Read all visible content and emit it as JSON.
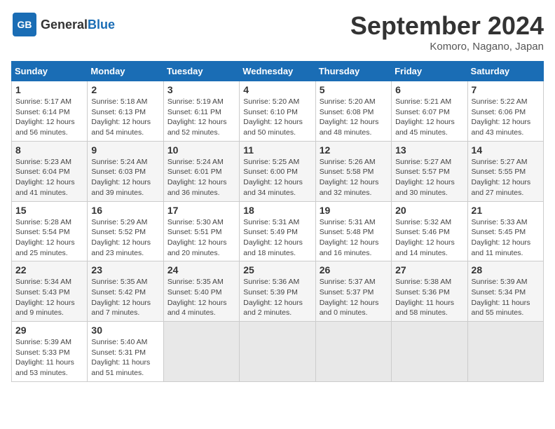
{
  "header": {
    "logo_general": "General",
    "logo_blue": "Blue",
    "month_title": "September 2024",
    "location": "Komoro, Nagano, Japan"
  },
  "days_of_week": [
    "Sunday",
    "Monday",
    "Tuesday",
    "Wednesday",
    "Thursday",
    "Friday",
    "Saturday"
  ],
  "weeks": [
    [
      {
        "day": "1",
        "sunrise": "5:17 AM",
        "sunset": "6:14 PM",
        "daylight": "12 hours and 56 minutes."
      },
      {
        "day": "2",
        "sunrise": "5:18 AM",
        "sunset": "6:13 PM",
        "daylight": "12 hours and 54 minutes."
      },
      {
        "day": "3",
        "sunrise": "5:19 AM",
        "sunset": "6:11 PM",
        "daylight": "12 hours and 52 minutes."
      },
      {
        "day": "4",
        "sunrise": "5:20 AM",
        "sunset": "6:10 PM",
        "daylight": "12 hours and 50 minutes."
      },
      {
        "day": "5",
        "sunrise": "5:20 AM",
        "sunset": "6:08 PM",
        "daylight": "12 hours and 48 minutes."
      },
      {
        "day": "6",
        "sunrise": "5:21 AM",
        "sunset": "6:07 PM",
        "daylight": "12 hours and 45 minutes."
      },
      {
        "day": "7",
        "sunrise": "5:22 AM",
        "sunset": "6:06 PM",
        "daylight": "12 hours and 43 minutes."
      }
    ],
    [
      {
        "day": "8",
        "sunrise": "5:23 AM",
        "sunset": "6:04 PM",
        "daylight": "12 hours and 41 minutes."
      },
      {
        "day": "9",
        "sunrise": "5:24 AM",
        "sunset": "6:03 PM",
        "daylight": "12 hours and 39 minutes."
      },
      {
        "day": "10",
        "sunrise": "5:24 AM",
        "sunset": "6:01 PM",
        "daylight": "12 hours and 36 minutes."
      },
      {
        "day": "11",
        "sunrise": "5:25 AM",
        "sunset": "6:00 PM",
        "daylight": "12 hours and 34 minutes."
      },
      {
        "day": "12",
        "sunrise": "5:26 AM",
        "sunset": "5:58 PM",
        "daylight": "12 hours and 32 minutes."
      },
      {
        "day": "13",
        "sunrise": "5:27 AM",
        "sunset": "5:57 PM",
        "daylight": "12 hours and 30 minutes."
      },
      {
        "day": "14",
        "sunrise": "5:27 AM",
        "sunset": "5:55 PM",
        "daylight": "12 hours and 27 minutes."
      }
    ],
    [
      {
        "day": "15",
        "sunrise": "5:28 AM",
        "sunset": "5:54 PM",
        "daylight": "12 hours and 25 minutes."
      },
      {
        "day": "16",
        "sunrise": "5:29 AM",
        "sunset": "5:52 PM",
        "daylight": "12 hours and 23 minutes."
      },
      {
        "day": "17",
        "sunrise": "5:30 AM",
        "sunset": "5:51 PM",
        "daylight": "12 hours and 20 minutes."
      },
      {
        "day": "18",
        "sunrise": "5:31 AM",
        "sunset": "5:49 PM",
        "daylight": "12 hours and 18 minutes."
      },
      {
        "day": "19",
        "sunrise": "5:31 AM",
        "sunset": "5:48 PM",
        "daylight": "12 hours and 16 minutes."
      },
      {
        "day": "20",
        "sunrise": "5:32 AM",
        "sunset": "5:46 PM",
        "daylight": "12 hours and 14 minutes."
      },
      {
        "day": "21",
        "sunrise": "5:33 AM",
        "sunset": "5:45 PM",
        "daylight": "12 hours and 11 minutes."
      }
    ],
    [
      {
        "day": "22",
        "sunrise": "5:34 AM",
        "sunset": "5:43 PM",
        "daylight": "12 hours and 9 minutes."
      },
      {
        "day": "23",
        "sunrise": "5:35 AM",
        "sunset": "5:42 PM",
        "daylight": "12 hours and 7 minutes."
      },
      {
        "day": "24",
        "sunrise": "5:35 AM",
        "sunset": "5:40 PM",
        "daylight": "12 hours and 4 minutes."
      },
      {
        "day": "25",
        "sunrise": "5:36 AM",
        "sunset": "5:39 PM",
        "daylight": "12 hours and 2 minutes."
      },
      {
        "day": "26",
        "sunrise": "5:37 AM",
        "sunset": "5:37 PM",
        "daylight": "12 hours and 0 minutes."
      },
      {
        "day": "27",
        "sunrise": "5:38 AM",
        "sunset": "5:36 PM",
        "daylight": "11 hours and 58 minutes."
      },
      {
        "day": "28",
        "sunrise": "5:39 AM",
        "sunset": "5:34 PM",
        "daylight": "11 hours and 55 minutes."
      }
    ],
    [
      {
        "day": "29",
        "sunrise": "5:39 AM",
        "sunset": "5:33 PM",
        "daylight": "11 hours and 53 minutes."
      },
      {
        "day": "30",
        "sunrise": "5:40 AM",
        "sunset": "5:31 PM",
        "daylight": "11 hours and 51 minutes."
      },
      null,
      null,
      null,
      null,
      null
    ]
  ]
}
